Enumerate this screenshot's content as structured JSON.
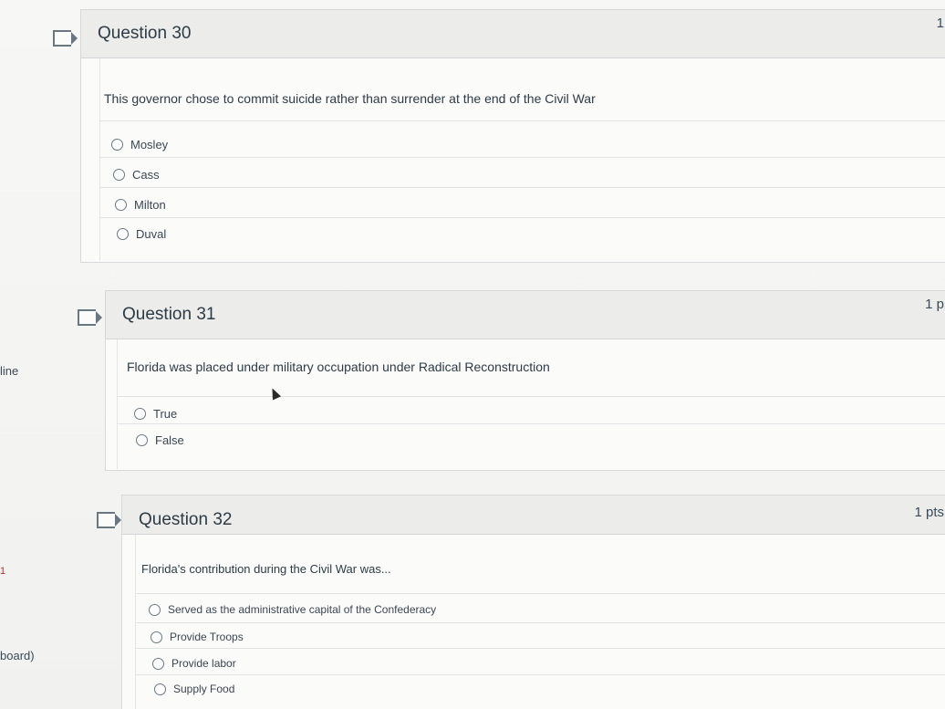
{
  "sidebar": {
    "label_line": "line",
    "label_board": "board)",
    "marker": "1"
  },
  "questions": [
    {
      "title": "Question 30",
      "points": "1",
      "text": "This governor chose to commit suicide rather than surrender at the end of the Civil War",
      "answers": [
        "Mosley",
        "Cass",
        "Milton",
        "Duval"
      ]
    },
    {
      "title": "Question 31",
      "points": "1 p",
      "text": "Florida was placed under military occupation under Radical Reconstruction",
      "answers": [
        "True",
        "False"
      ]
    },
    {
      "title": "Question 32",
      "points": "1 pts",
      "text": "Florida's contribution during the Civil War was...",
      "answers": [
        "Served as the administrative capital of the Confederacy",
        "Provide Troops",
        "Provide labor",
        "Supply Food"
      ]
    }
  ],
  "icons": {
    "flag": "flag-icon",
    "radio": "radio-button-icon",
    "cursor": "mouse-cursor-icon"
  }
}
